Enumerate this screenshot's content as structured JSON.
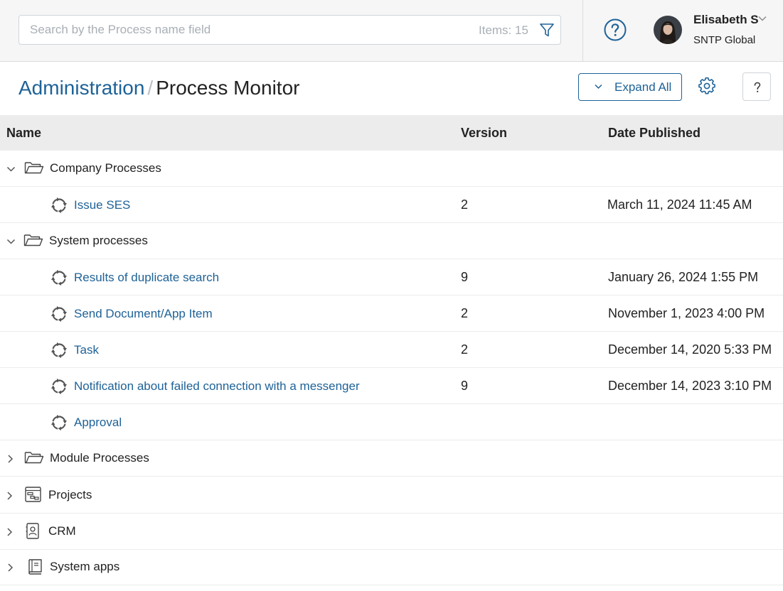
{
  "search": {
    "placeholder": "Search by the Process name field",
    "items_label": "Items: 15"
  },
  "user": {
    "name": "Elisabeth S",
    "company": "SNTP Global"
  },
  "breadcrumb": {
    "parent": "Administration",
    "separator": "/",
    "current": "Process Monitor"
  },
  "toolbar": {
    "expand_all_label": "Expand All"
  },
  "table": {
    "columns": {
      "name": "Name",
      "version": "Version",
      "date": "Date Published"
    },
    "groups": {
      "company": {
        "label": "Company Processes",
        "processes": [
          {
            "name": "Issue SES",
            "version": "2",
            "date": "March 11, 2024 11:45 AM"
          }
        ]
      },
      "system": {
        "label": "System processes",
        "processes": [
          {
            "name": "Results of duplicate search",
            "version": "9",
            "date": "January 26, 2024 1:55 PM"
          },
          {
            "name": "Send Document/App Item",
            "version": "2",
            "date": "November 1, 2023 4:00 PM"
          },
          {
            "name": "Task",
            "version": "2",
            "date": "December 14, 2020 5:33 PM"
          },
          {
            "name": "Notification about failed connection with a messenger",
            "version": "9",
            "date": "December 14, 2023 3:10 PM"
          },
          {
            "name": "Approval",
            "version": "",
            "date": ""
          }
        ]
      },
      "module": {
        "label": "Module Processes"
      },
      "projects": {
        "label": "Projects"
      },
      "crm": {
        "label": "CRM"
      },
      "system_apps": {
        "label": "System apps"
      }
    }
  },
  "colors": {
    "accent": "#1e6297",
    "header_bg": "#f6f6f6",
    "table_header_bg": "#ececec",
    "border": "#cfd4d9"
  },
  "icons": {
    "filter": "filter-icon",
    "help": "help-circle-icon",
    "settings": "gear-icon",
    "folder": "folder-open-icon",
    "process": "process-cycle-icon",
    "projects": "projects-board-icon",
    "crm": "contact-card-icon",
    "system_apps": "book-icon"
  }
}
